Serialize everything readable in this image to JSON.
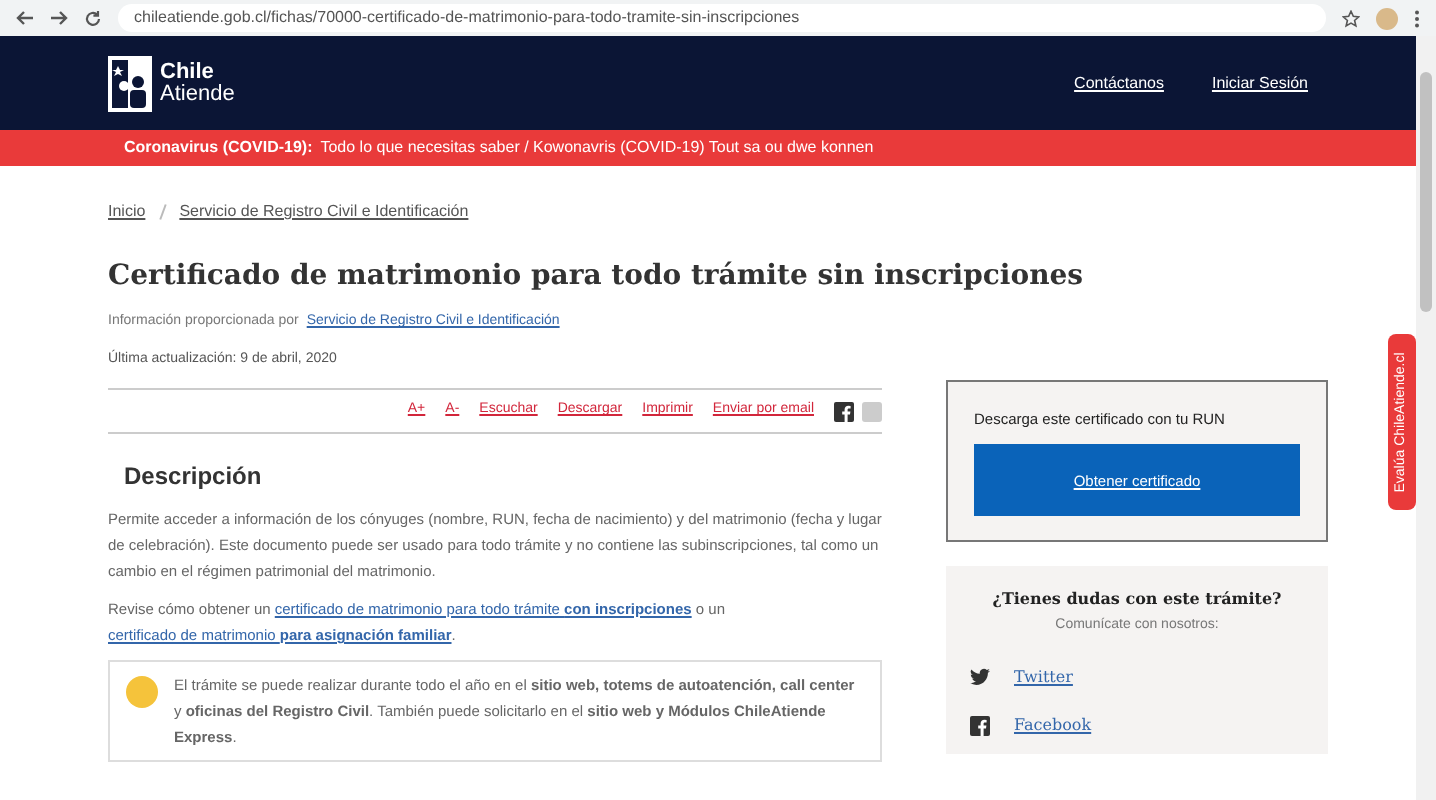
{
  "browser": {
    "url": "chileatiende.gob.cl/fichas/70000-certificado-de-matrimonio-para-todo-tramite-sin-inscripciones"
  },
  "header": {
    "logo_lines": [
      "Chile",
      "Atiende"
    ],
    "links": [
      "Contáctanos",
      "Iniciar Sesión"
    ]
  },
  "alert": {
    "label": "Coronavirus (COVID-19):",
    "text": "Todo lo que necesitas saber / Kowonavris (COVID-19) Tout sa ou dwe konnen"
  },
  "breadcrumb": [
    "Inicio",
    "Servicio de Registro Civil e Identificación"
  ],
  "title": "Certificado de matrimonio para todo trámite sin inscripciones",
  "provided_by": {
    "label": "Información proporcionada por",
    "link": "Servicio de Registro Civil e Identificación"
  },
  "updated": "Última actualización: 9 de abril, 2020",
  "tools": [
    "A+",
    "A-",
    "Escuchar",
    "Descargar",
    "Imprimir",
    "Enviar por email"
  ],
  "section_title": "Descripción",
  "paragraph": "Permite acceder a información de los cónyuges (nombre, RUN, fecha de nacimiento) y del matrimonio (fecha y lugar de celebración). Este documento puede ser usado para todo trámite y no contiene las subinscripciones, tal como un cambio en el régimen patrimonial del matrimonio.",
  "revise": [
    {
      "kind": "text",
      "text": "Revise cómo obtener un "
    },
    {
      "kind": "link",
      "text": "certificado de matrimonio para todo trámite **con inscripciones**"
    },
    {
      "kind": "text",
      "text": " o un "
    },
    {
      "kind": "link",
      "text": "certificado de matrimonio **para asignación familiar**"
    },
    {
      "kind": "text",
      "text": "."
    }
  ],
  "info_box": "El trámite se puede realizar durante todo el año en el **sitio web, totems de autoatención, call center** y **oficinas del Registro Civil**. También puede solicitarlo en el **sitio web y Módulos ChileAtiende Express**.",
  "download_card": {
    "title": "Descarga este certificado con tu RUN",
    "button": "Obtener certificado"
  },
  "help_card": {
    "title": "¿Tienes dudas con este trámite?",
    "subtitle": "Comunícate con nosotros:",
    "links": [
      {
        "kind": "twitter",
        "label": "Twitter"
      },
      {
        "kind": "facebook",
        "label": "Facebook"
      }
    ]
  },
  "feedback_tab": "Evalúa ChileAtiende.cl"
}
